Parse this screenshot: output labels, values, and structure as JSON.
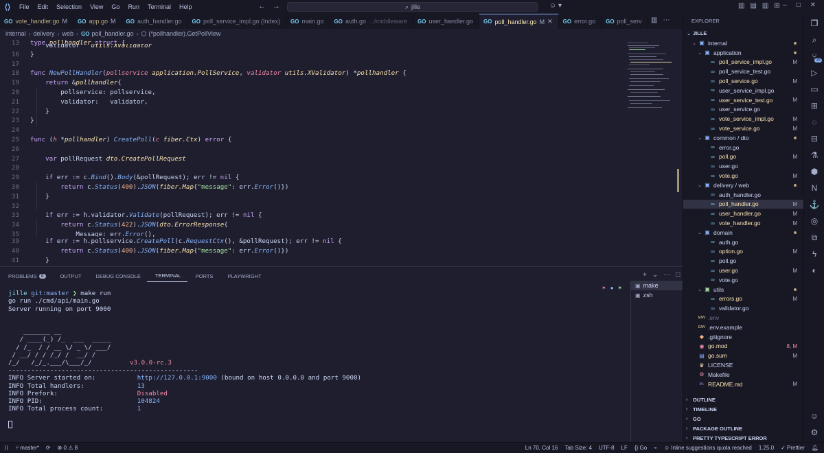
{
  "titlebar": {
    "menu": [
      "File",
      "Edit",
      "Selection",
      "View",
      "Go",
      "Run",
      "Terminal",
      "Help"
    ],
    "search": "jille"
  },
  "tabs": [
    {
      "label": "vote_handler.go",
      "status": "M",
      "state": "mod"
    },
    {
      "label": "app.go",
      "status": "M",
      "state": "mod"
    },
    {
      "label": "auth_handler.go",
      "status": "",
      "state": "normal"
    },
    {
      "label": "poll_service_impl.go (Index)",
      "status": "",
      "state": "normal"
    },
    {
      "label": "main.go",
      "status": "",
      "state": "normal"
    },
    {
      "label": "auth.go",
      "status": "",
      "state": "normal",
      "hint": ".../middleware"
    },
    {
      "label": "user_handler.go",
      "status": "",
      "state": "normal"
    },
    {
      "label": "poll_handler.go",
      "status": "M",
      "state": "active"
    },
    {
      "label": "error.go",
      "status": "",
      "state": "normal"
    },
    {
      "label": "poll_serv",
      "status": "",
      "state": "normal"
    }
  ],
  "breadcrumb": [
    "internal",
    "delivery",
    "web",
    "poll_handler.go",
    "(*pollhandler).GetPollView"
  ],
  "editor": {
    "line_numbers": [
      "13",
      "14",
      "16",
      "17",
      "18",
      "19",
      "20",
      "21",
      "22",
      "23",
      "24",
      "25",
      "26",
      "27",
      "28",
      "29",
      "30",
      "31",
      "32",
      "33",
      "34",
      "35",
      "36",
      "37",
      "38",
      "39",
      "40",
      "41"
    ]
  },
  "panel": {
    "tabs": [
      "PROBLEMS",
      "OUTPUT",
      "DEBUG CONSOLE",
      "TERMINAL",
      "PORTS",
      "PLAYWRIGHT"
    ],
    "problems_count": "8",
    "active_tab": "TERMINAL",
    "terminals": [
      "make",
      "zsh"
    ],
    "prompt_user": "jille",
    "prompt_git": "git:master",
    "prompt_cmd": "make run",
    "line_go": "go run ./cmd/api/main.go",
    "line_running": "Server running on port 9000",
    "banner_version": "v3.0.0-rc.3",
    "divider": "--------------------------------------------------",
    "info": [
      {
        "prefix": "INFO",
        "key": "Server started on:",
        "value": "http://127.0.0.1:9000",
        "extra": " (bound on host 0.0.0.0 and port 9000)"
      },
      {
        "prefix": "INFO",
        "key": "Total handlers:",
        "value": "13",
        "extra": ""
      },
      {
        "prefix": "INFO",
        "key": "Prefork:",
        "value": "Disabled",
        "extra": ""
      },
      {
        "prefix": "INFO",
        "key": "PID:",
        "value": "104824",
        "extra": ""
      },
      {
        "prefix": "INFO",
        "key": "Total process count:",
        "value": "1",
        "extra": ""
      }
    ]
  },
  "explorer": {
    "title": "EXPLORER",
    "root": "JILLE",
    "items": [
      {
        "name": "internal",
        "type": "folder",
        "depth": 1,
        "mark": "dot"
      },
      {
        "name": "application",
        "type": "folder",
        "depth": 2,
        "mark": "dot"
      },
      {
        "name": "poll_service_impl.go",
        "type": "go",
        "depth": 3,
        "mark": "M"
      },
      {
        "name": "poll_service_test.go",
        "type": "go",
        "depth": 3,
        "mark": ""
      },
      {
        "name": "poll_service.go",
        "type": "go",
        "depth": 3,
        "mark": "M"
      },
      {
        "name": "user_service_impl.go",
        "type": "go",
        "depth": 3,
        "mark": ""
      },
      {
        "name": "user_service_test.go",
        "type": "go",
        "depth": 3,
        "mark": "M"
      },
      {
        "name": "user_service.go",
        "type": "go",
        "depth": 3,
        "mark": ""
      },
      {
        "name": "vote_service_impl.go",
        "type": "go",
        "depth": 3,
        "mark": "M"
      },
      {
        "name": "vote_service.go",
        "type": "go",
        "depth": 3,
        "mark": "M"
      },
      {
        "name": "common / dto",
        "type": "folder",
        "depth": 2,
        "mark": "dot"
      },
      {
        "name": "error.go",
        "type": "go",
        "depth": 3,
        "mark": ""
      },
      {
        "name": "poll.go",
        "type": "go",
        "depth": 3,
        "mark": "M"
      },
      {
        "name": "user.go",
        "type": "go",
        "depth": 3,
        "mark": ""
      },
      {
        "name": "vote.go",
        "type": "go",
        "depth": 3,
        "mark": "M"
      },
      {
        "name": "delivery / web",
        "type": "folder",
        "depth": 2,
        "mark": "dot"
      },
      {
        "name": "auth_handler.go",
        "type": "go",
        "depth": 3,
        "mark": ""
      },
      {
        "name": "poll_handler.go",
        "type": "go",
        "depth": 3,
        "mark": "M",
        "selected": true
      },
      {
        "name": "user_handler.go",
        "type": "go",
        "depth": 3,
        "mark": "M"
      },
      {
        "name": "vote_handler.go",
        "type": "go",
        "depth": 3,
        "mark": "M"
      },
      {
        "name": "domain",
        "type": "folder",
        "depth": 2,
        "mark": "dot"
      },
      {
        "name": "auth.go",
        "type": "go",
        "depth": 3,
        "mark": ""
      },
      {
        "name": "option.go",
        "type": "go",
        "depth": 3,
        "mark": "M"
      },
      {
        "name": "poll.go",
        "type": "go",
        "depth": 3,
        "mark": ""
      },
      {
        "name": "user.go",
        "type": "go",
        "depth": 3,
        "mark": "M"
      },
      {
        "name": "vote.go",
        "type": "go",
        "depth": 3,
        "mark": ""
      },
      {
        "name": "utils",
        "type": "folder-u",
        "depth": 2,
        "mark": "dot"
      },
      {
        "name": "errors.go",
        "type": "go",
        "depth": 3,
        "mark": "M"
      },
      {
        "name": "validator.go",
        "type": "go",
        "depth": 3,
        "mark": ""
      },
      {
        "name": ".env",
        "type": "env",
        "depth": 1,
        "mark": "",
        "dim": true
      },
      {
        "name": ".env.example",
        "type": "env",
        "depth": 1,
        "mark": ""
      },
      {
        "name": ".gitignore",
        "type": "git",
        "depth": 1,
        "mark": ""
      },
      {
        "name": "go.mod",
        "type": "gomod",
        "depth": 1,
        "mark": "8, M"
      },
      {
        "name": "go.sum",
        "type": "gosum",
        "depth": 1,
        "mark": "M"
      },
      {
        "name": "LICENSE",
        "type": "license",
        "depth": 1,
        "mark": ""
      },
      {
        "name": "Makefile",
        "type": "make",
        "depth": 1,
        "mark": ""
      },
      {
        "name": "README.md",
        "type": "md",
        "depth": 1,
        "mark": "M"
      }
    ],
    "sections": [
      "OUTLINE",
      "TIMELINE",
      "GO",
      "PACKAGE OUTLINE",
      "PRETTY TYPESCRIPT ERROR"
    ]
  },
  "activity": {
    "source_control_count": "26"
  },
  "statusbar": {
    "branch": "master*",
    "errors": "0",
    "warnings": "8",
    "position": "Ln 70, Col 16",
    "tab_size": "Tab Size: 4",
    "encoding": "UTF-8",
    "eol": "LF",
    "language": "Go",
    "quota": "Inline suggestions quota reached",
    "go_version": "1.25.0",
    "prettier": "Prettier"
  }
}
